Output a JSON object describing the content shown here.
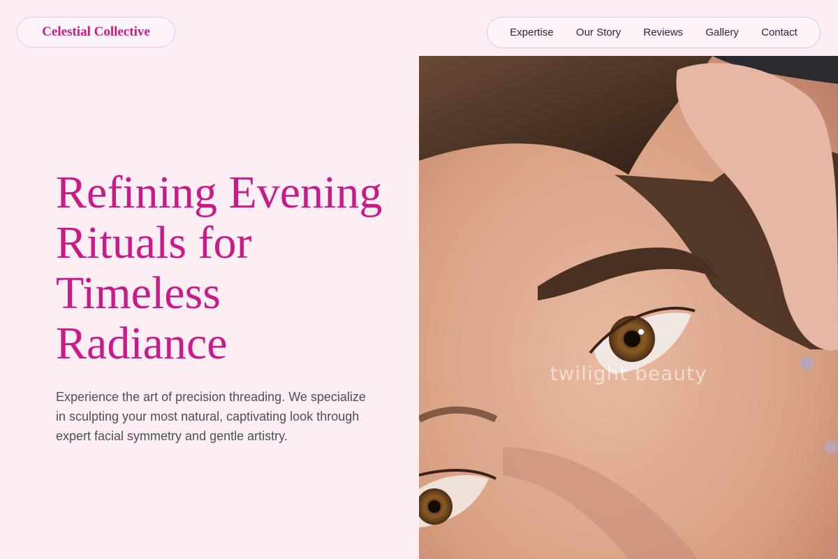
{
  "brand": {
    "name": "Celestial Collective",
    "accent": "#c81b88"
  },
  "nav": {
    "items": [
      {
        "label": "Expertise"
      },
      {
        "label": "Our Story"
      },
      {
        "label": "Reviews"
      },
      {
        "label": "Gallery"
      },
      {
        "label": "Contact"
      }
    ]
  },
  "hero": {
    "headline": "Refining Evening Rituals for Timeless Radiance",
    "subtext": "Experience the art of precision threading. We specialize in sculpting your most natural, captivating look through expert facial symmetry and gentle artistry.",
    "image_watermark": "twilight beauty"
  }
}
